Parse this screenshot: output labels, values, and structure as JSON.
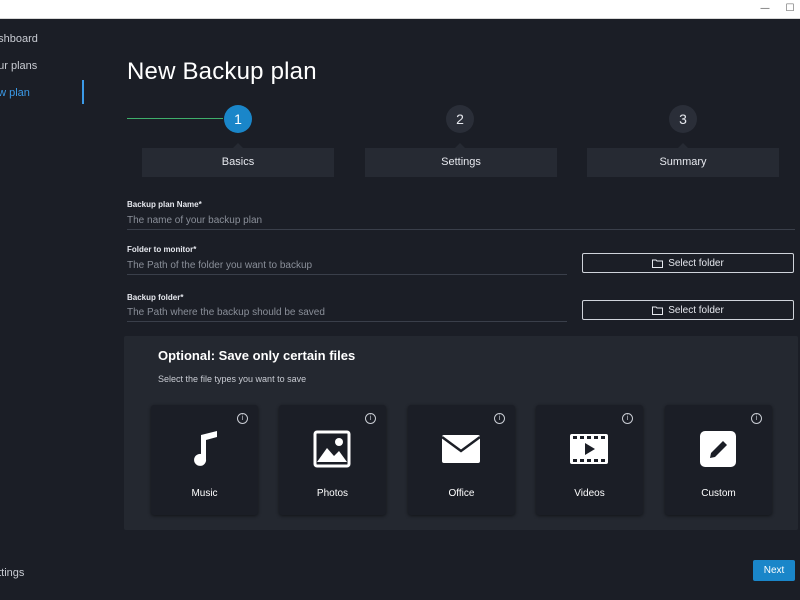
{
  "window": {
    "minimize_glyph": "—",
    "maximize_glyph": "☐"
  },
  "sidebar": {
    "items": [
      {
        "label": "ashboard"
      },
      {
        "label": "our plans"
      },
      {
        "label": "ew plan"
      }
    ],
    "settings_label": "ettings"
  },
  "main": {
    "title": "New Backup plan",
    "steps": [
      {
        "number": "1",
        "label": "Basics"
      },
      {
        "number": "2",
        "label": "Settings"
      },
      {
        "number": "3",
        "label": "Summary"
      }
    ],
    "fields": {
      "plan_name": {
        "label": "Backup plan Name*",
        "placeholder": "The name of your backup plan"
      },
      "monitor": {
        "label": "Folder to monitor*",
        "placeholder": "The Path of the folder you want to backup",
        "button": "Select folder"
      },
      "backup": {
        "label": "Backup folder*",
        "placeholder": "The Path where the backup should be saved",
        "button": "Select folder"
      }
    },
    "optional": {
      "title": "Optional: Save only certain files",
      "subtitle": "Select the file types you want to save",
      "types": [
        {
          "label": "Music",
          "icon": "music-note-icon"
        },
        {
          "label": "Photos",
          "icon": "photo-icon"
        },
        {
          "label": "Office",
          "icon": "envelope-icon"
        },
        {
          "label": "Videos",
          "icon": "video-icon"
        },
        {
          "label": "Custom",
          "icon": "pencil-icon"
        }
      ],
      "info_glyph": "i"
    },
    "next_label": "Next"
  },
  "colors": {
    "accent": "#1a86c9",
    "progress_done": "#3fae6b",
    "background": "#1b1e26"
  }
}
